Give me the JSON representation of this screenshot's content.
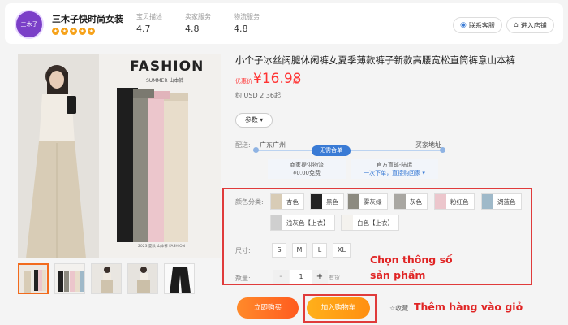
{
  "shop": {
    "logo_text": "三木子",
    "name": "三木子快时尚女装",
    "rating_star": "★",
    "metrics": [
      {
        "label": "宝贝描述",
        "value": "4.7"
      },
      {
        "label": "卖家服务",
        "value": "4.8"
      },
      {
        "label": "物流服务",
        "value": "4.8"
      }
    ],
    "contact_label": "联系客服",
    "enter_label": "进入店铺"
  },
  "gallery": {
    "fashion_text": "FASHION",
    "subtitle": "SUMMER·山本裤",
    "footer_text": "2023 夏款 山本裤 FASHION"
  },
  "product": {
    "title": "小个子冰丝阔腿休闲裤女夏季薄款裤子新款高腰宽松直筒裤意山本裤",
    "price_label": "优惠价",
    "price": "¥16.98",
    "price_suffix": "起",
    "usd": "约 USD 2.36起",
    "params_label": "参数 ▾"
  },
  "shipping": {
    "label": "配送:",
    "from": "广东广州",
    "to": "买家地址",
    "badge": "无需合单",
    "box1_line1": "商家提供物流",
    "box1_line2": "¥0.00免费",
    "box2_line1": "官方直邮-陆运",
    "box2_line2": "一次下单，直接购回家 ▾"
  },
  "options": {
    "color_label": "颜色分类:",
    "colors": [
      "杏色",
      "黑色",
      "雾灰绿",
      "灰色",
      "粉红色",
      "湖蓝色",
      "浅灰色【上衣】",
      "白色【上衣】"
    ],
    "size_label": "尺寸:",
    "sizes": [
      "S",
      "M",
      "L",
      "XL"
    ],
    "qty_label": "数量:",
    "qty_minus": "-",
    "qty_value": "1",
    "qty_plus": "+",
    "stock_text": "有货"
  },
  "annotations": {
    "spec_line1": "Chọn thông số",
    "spec_line2": "sản phẩm",
    "cart_note": "Thêm hàng vào giỏ"
  },
  "actions": {
    "buy_now": "立即购买",
    "add_cart": "加入购物车",
    "favorite": "☆收藏"
  },
  "colors": {
    "price_red": "#ff3333",
    "annotation_red": "#e02424",
    "buy_orange": "#ff6a22",
    "cart_orange": "#ffa016",
    "link_blue": "#3a7bd5"
  }
}
